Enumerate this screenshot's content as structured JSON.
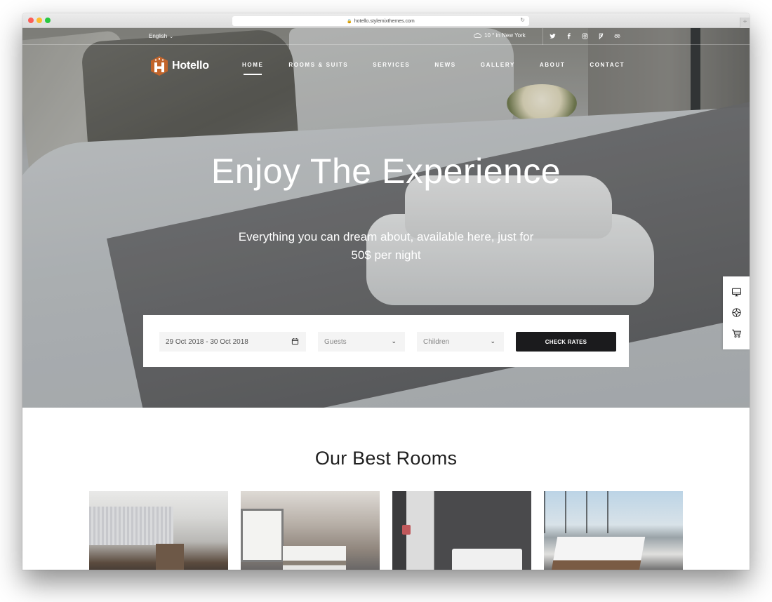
{
  "browser": {
    "url": "hotello.stylemixthemes.com"
  },
  "topbar": {
    "language": "English",
    "weather": "10 ° in New York",
    "socials": [
      "twitter-icon",
      "facebook-icon",
      "instagram-icon",
      "foursquare-icon",
      "tripadvisor-icon"
    ]
  },
  "brand": {
    "name": "Hotello",
    "accent": "#c2642a"
  },
  "nav": {
    "items": [
      {
        "label": "HOME",
        "active": true
      },
      {
        "label": "ROOMS & SUITS"
      },
      {
        "label": "SERVICES"
      },
      {
        "label": "NEWS"
      },
      {
        "label": "GALLERY"
      },
      {
        "label": "ABOUT"
      },
      {
        "label": "CONTACT"
      }
    ]
  },
  "hero": {
    "title": "Enjoy The Experience",
    "subtitle": "Everything you can dream about, available here, just for 50$ per night"
  },
  "booking": {
    "dates": "29 Oct 2018 - 30 Oct 2018",
    "guests_placeholder": "Guests",
    "children_placeholder": "Children",
    "submit_label": "CHECK RATES"
  },
  "side_tools": [
    "monitor-icon",
    "lifebuoy-icon",
    "cart-icon"
  ],
  "rooms_section": {
    "title": "Our Best Rooms",
    "rooms": [
      {
        "image": "room-photo-1"
      },
      {
        "image": "room-photo-2"
      },
      {
        "image": "room-photo-3"
      },
      {
        "image": "room-photo-4"
      }
    ]
  }
}
